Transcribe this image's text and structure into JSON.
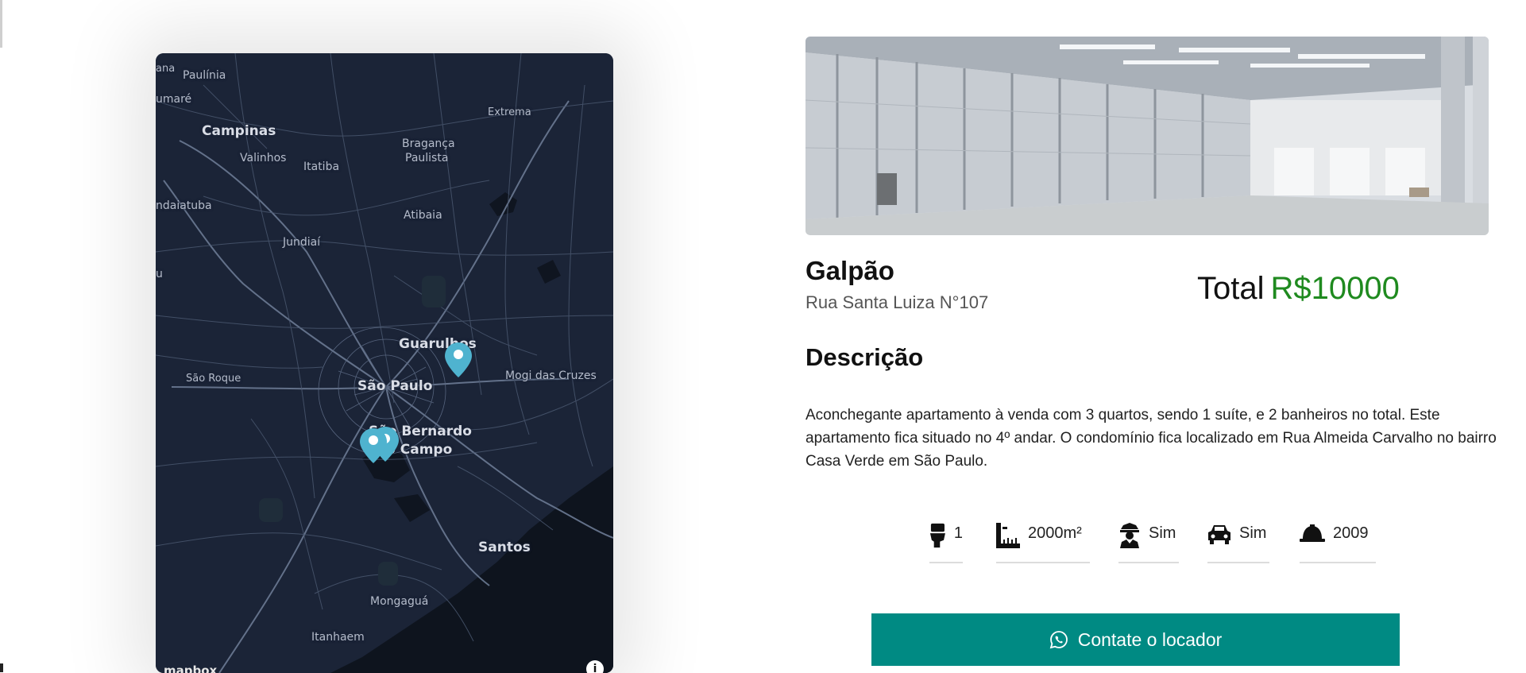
{
  "map": {
    "labels": {
      "parana": "ana",
      "paulinia": "Paulínia",
      "sumare": "umaré",
      "campinas": "Campinas",
      "valinhos": "Valinhos",
      "itatiba": "Itatiba",
      "braganca": "Bragança",
      "paulista": "Paulista",
      "extrema": "Extrema",
      "indaiatuba": "ndaiatuba",
      "atibaia": "Atibaia",
      "jundiai": "Jundiaí",
      "itu": "u",
      "guarulhos": "Guarulhos",
      "sao_roque": "São Roque",
      "mogi": "Mogi das Cruzes",
      "sao_paulo": "São Paulo",
      "sao_bernardo": "São Bernardo",
      "do_campo": "do Campo",
      "santos": "Santos",
      "mongagua": "Mongaguá",
      "itanhaem": "Itanhaem"
    },
    "attribution": "mapbox",
    "info_button": "i",
    "marker_icon": "map-pin-icon"
  },
  "listing": {
    "image_alt": "warehouse-interior-photo",
    "title": "Galpão",
    "address": "Rua Santa Luiza N°107",
    "total_label": "Total",
    "price": "R$10000",
    "description_heading": "Descrição",
    "description": "Aconchegante apartamento à venda com 3 quartos, sendo 1 suíte, e 2 banheiros no total. Este apartamento fica situado no 4º andar. O condomínio fica localizado em Rua Almeida Carvalho no bairro Casa Verde em São Paulo."
  },
  "features": [
    {
      "icon": "toilet-icon",
      "value": "1"
    },
    {
      "icon": "ruler-area-icon",
      "value": "2000m²"
    },
    {
      "icon": "security-guard-icon",
      "value": "Sim"
    },
    {
      "icon": "car-icon",
      "value": "Sim"
    },
    {
      "icon": "construction-helmet-icon",
      "value": "2009"
    }
  ],
  "contact": {
    "label": "Contate o locador",
    "icon": "whatsapp-icon"
  },
  "colors": {
    "price": "#1f8a1f",
    "button": "#008a83",
    "map_bg": "#1b2437",
    "pin": "#4fb3cf"
  }
}
